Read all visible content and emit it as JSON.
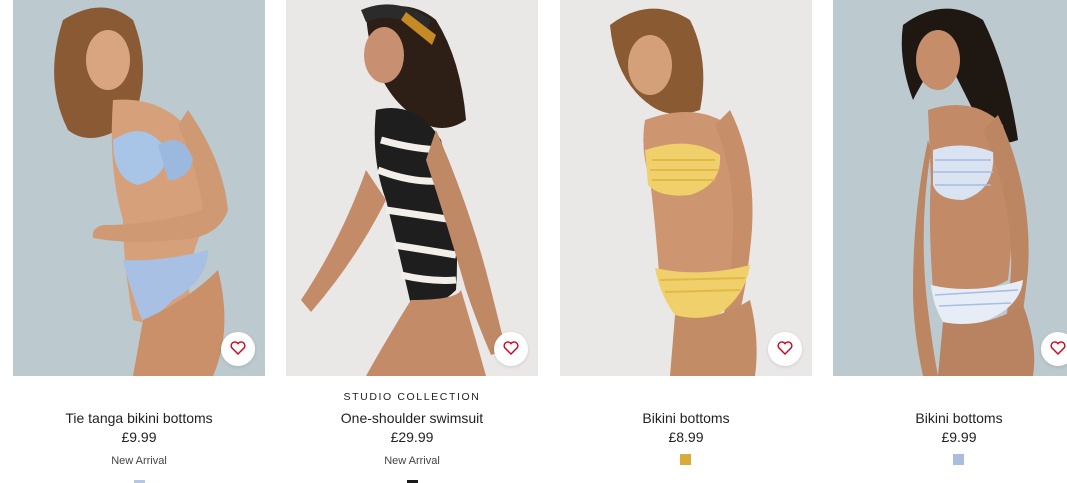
{
  "products": [
    {
      "collection": "",
      "title": "Tie tanga bikini bottoms",
      "price": "£9.99",
      "badge": "New Arrival",
      "swatch_color": "#b9c6e2",
      "favorite_icon": "heart-icon"
    },
    {
      "collection": "STUDIO COLLECTION",
      "title": "One-shoulder swimsuit",
      "price": "£29.99",
      "badge": "New Arrival",
      "swatch_color": "#1a1a1a",
      "favorite_icon": "heart-icon"
    },
    {
      "collection": "",
      "title": "Bikini bottoms",
      "price": "£8.99",
      "badge": "",
      "swatch_color": "#d9ab3b",
      "favorite_icon": "heart-icon"
    },
    {
      "collection": "",
      "title": "Bikini bottoms",
      "price": "£9.99",
      "badge": "",
      "swatch_color": "#a9bde0",
      "favorite_icon": "heart-icon"
    }
  ],
  "colors": {
    "heart_accent": "#d0021b",
    "photo_bg_blue": "#bcc9cf",
    "photo_bg_light": "#e9e8e6"
  }
}
